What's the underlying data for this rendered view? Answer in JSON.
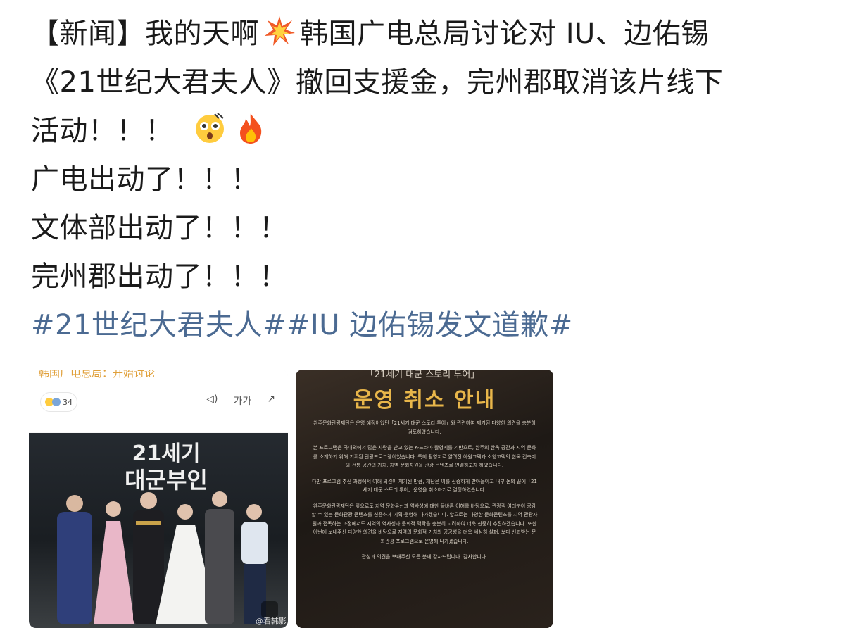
{
  "post": {
    "lines": [
      "【新闻】我的天啊",
      "韩国广电总局讨论对 IU、边佑锡",
      "《21世纪大君夫人》撤回支援金，完州郡取消该片线下",
      "活动！！！",
      "广电出动了！！！",
      "文体部出动了！！！",
      "完州郡出动了！！！"
    ],
    "hashtags": "#21世纪大君夫人##IU 边佑锡发文道歉#",
    "emoji": [
      "collision-emoji",
      "astonished-face-emoji",
      "fire-emoji"
    ]
  },
  "thumb1": {
    "header_text": "韩国广电总局：开始讨论",
    "reaction_count": "34",
    "tools_text": "가가",
    "poster_title_line1": "21세기",
    "poster_title_line2": "대군부인",
    "watermark": "@看韩影"
  },
  "thumb2": {
    "top_text": "「21세기 대군 스토리 투어」",
    "title": "운영 취소 안내",
    "paragraphs": [
      "완주문화관광재단은 운영 예정이었던「21세기 대군 스토리 투어」와 관련하여 제기된 다양한 의견을 충분히 검토하였습니다.",
      "본 프로그램은 국내외에서 많은 사랑을 받고 있는 K-드라마 촬영지를 기반으로, 완주의 한옥 공간과 지역 문화를 소개하기 위해 기획된 관광프로그램이었습니다. 특히 촬영지로 알려진 아원고택과 소양고택의 한옥 건축미와 전통 공간의 가치, 지역 문화자원을 관광 콘텐츠로 연결하고자 하였습니다.",
      "다만 프로그램 추진 과정에서 여러 의견이 제기된 만큼, 재단은 이를 신중하게 받아들이고 내부 논의 끝에「21세기 대군 스토리 투어」운영을 취소하기로 결정하였습니다.",
      "완주문화관광재단은 앞으로도 지역 문화유산과 역사성에 대한 올바른 이해를 바탕으로, 관광객 여러분이 공감할 수 있는 문화관광 콘텐츠를 신중하게 기획·운영해 나가겠습니다. 앞으로는 다양한 문화콘텐츠를 지역 관광자원과 접목하는 과정에서도 지역의 역사성과 문화적 맥락을 충분히 고려하여 더욱 신중히 추진하겠습니다. 또한 이번에 보내주신 다양한 의견을 바탕으로 지역의 문화적 가치와 공공성을 더욱 세심히 살펴, 보다 신뢰받는 문화관광 프로그램으로 운영해 나가겠습니다.",
      "관심과 의견을 보내주신 모든 분께 감사드립니다. 감사합니다."
    ]
  },
  "colors": {
    "text": "#1a1a1a",
    "hashtag": "#4b6a92",
    "title_gold": "#e8b64a"
  }
}
